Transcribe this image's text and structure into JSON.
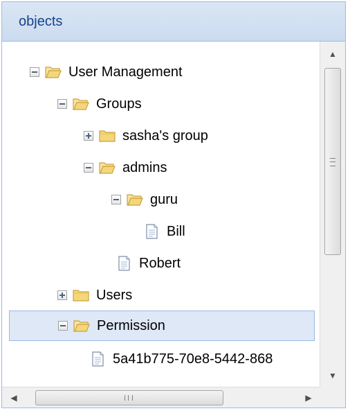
{
  "panel": {
    "title": "objects"
  },
  "tree": {
    "nodes": [
      {
        "label": "User Management",
        "icon": "folder-open-icon",
        "toggle": "minus"
      },
      {
        "label": "Groups",
        "icon": "folder-open-icon",
        "toggle": "minus"
      },
      {
        "label": "sasha's group",
        "icon": "folder-closed-icon",
        "toggle": "plus"
      },
      {
        "label": "admins",
        "icon": "folder-open-icon",
        "toggle": "minus"
      },
      {
        "label": "guru",
        "icon": "folder-open-icon",
        "toggle": "minus"
      },
      {
        "label": "Bill",
        "icon": "document-icon",
        "toggle": "none"
      },
      {
        "label": "Robert",
        "icon": "document-icon",
        "toggle": "none"
      },
      {
        "label": "Users",
        "icon": "folder-closed-icon",
        "toggle": "plus"
      },
      {
        "label": "Permission",
        "icon": "folder-open-icon",
        "toggle": "minus",
        "selected": true
      },
      {
        "label": "5a41b775-70e8-5442-868",
        "icon": "document-icon",
        "toggle": "none"
      }
    ]
  },
  "colors": {
    "header": "#cbdbef",
    "border": "#99bbe8",
    "selection": "#dfe8f6",
    "folder": "#f5d77a"
  }
}
